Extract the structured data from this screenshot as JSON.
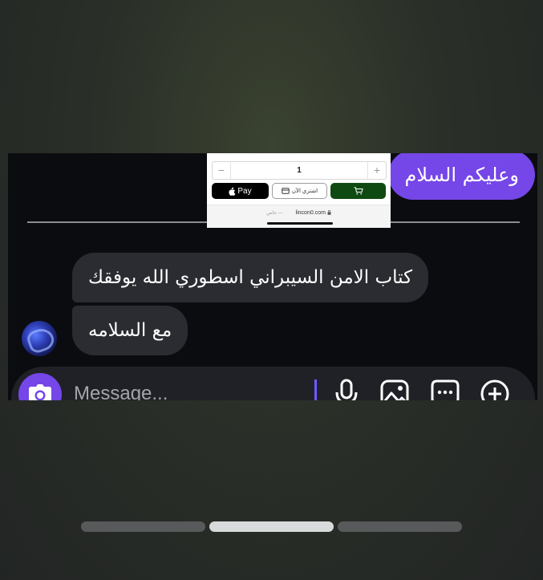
{
  "chat": {
    "sent_message": "وعليكم السلام",
    "received_messages": [
      "كتاب الامن السيبراني اسطوري الله يوفقك",
      "مع السلامه"
    ],
    "composer": {
      "placeholder": "Message..."
    }
  },
  "shop_preview": {
    "quantity": "1",
    "minus_label": "−",
    "plus_label": "+",
    "apple_pay_label": "Pay",
    "buy_now_label": "اشتري الآن",
    "url": "lincon0.com",
    "private_label": "خاص —"
  },
  "page_indicator": {
    "count": 3,
    "active_index": 1
  },
  "colors": {
    "accent": "#7546e8",
    "chat_background": "#0b0c10",
    "received_bubble": "#2b2c31",
    "cart_button": "#0f4a12"
  }
}
